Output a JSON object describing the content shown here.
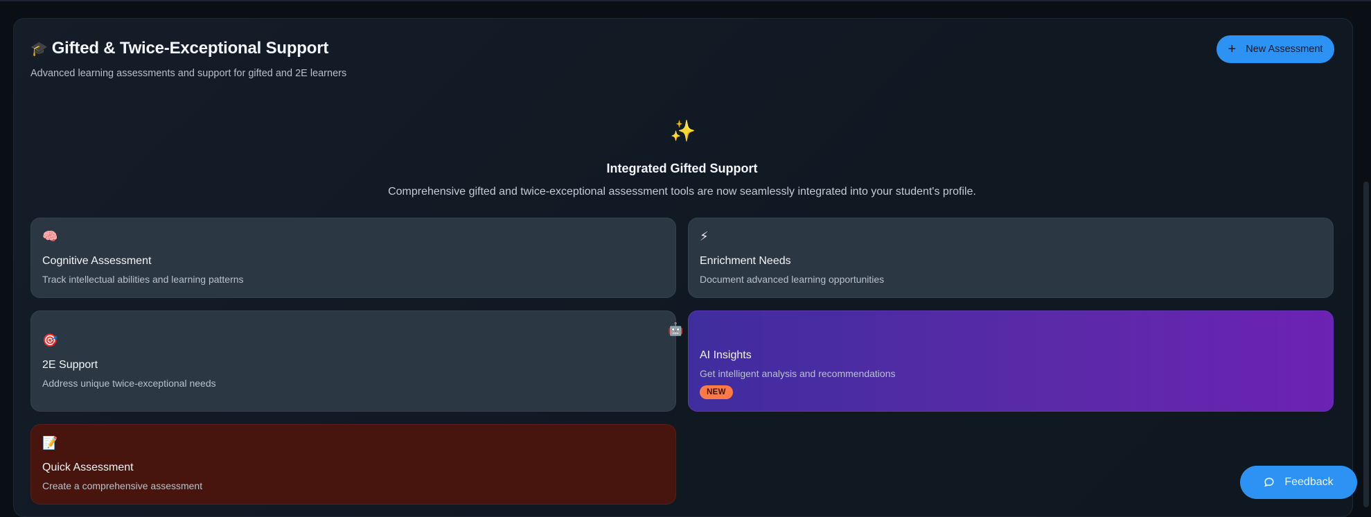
{
  "header": {
    "icon": "graduation-cap-icon",
    "icon_glyph": "🎓",
    "title": "Gifted & Twice-Exceptional Support",
    "subtitle": "Advanced learning assessments and support for gifted and 2E learners",
    "new_button_label": "New Assessment"
  },
  "hero": {
    "icon": "sparkles-icon",
    "icon_glyph": "✨",
    "title": "Integrated Gifted Support",
    "description": "Comprehensive gifted and twice-exceptional assessment tools are now seamlessly integrated into your student's profile."
  },
  "cards": {
    "cognitive": {
      "icon": "brain-icon",
      "icon_glyph": "🧠",
      "title": "Cognitive Assessment",
      "description": "Track intellectual abilities and learning patterns"
    },
    "enrichment": {
      "icon": "lightning-icon",
      "icon_glyph": "⚡",
      "title": "Enrichment Needs",
      "description": "Document advanced learning opportunities"
    },
    "twoe": {
      "icon": "target-icon",
      "icon_glyph": "🎯",
      "title": "2E Support",
      "description": "Address unique twice-exceptional needs"
    },
    "ai": {
      "icon": "robot-icon",
      "icon_glyph": "🤖",
      "title": "AI Insights",
      "description": "Get intelligent analysis and recommendations",
      "badge": "NEW"
    },
    "quick": {
      "icon": "memo-icon",
      "icon_glyph": "📝",
      "title": "Quick Assessment",
      "description": "Create a comprehensive assessment"
    }
  },
  "feedback_button": {
    "label": "Feedback",
    "icon": "chat-bubble-icon"
  },
  "colors": {
    "accent": "#2c93f5",
    "badge": "#ff7a45",
    "ai_card_from": "#3f2d9e",
    "ai_card_to": "#6c22b3",
    "quick_card": "#47150d"
  }
}
